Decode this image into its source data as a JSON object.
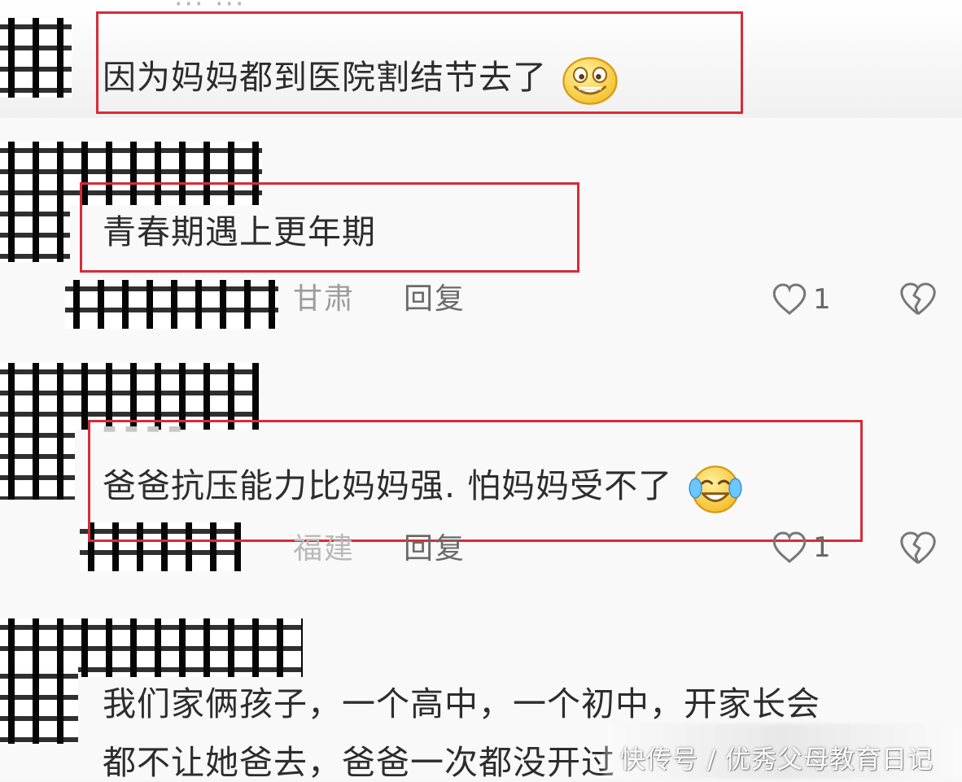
{
  "comments": [
    {
      "text": "因为妈妈都到医院割结节去了",
      "emoji": "grin-emoji"
    },
    {
      "text": "青春期遇上更年期",
      "location": "甘肃",
      "reply": "回复",
      "likes": "1"
    },
    {
      "text": "爸爸抗压能力比妈妈强. 怕妈妈受不了",
      "emoji": "laugh-cry-emoji",
      "location": "福建",
      "reply": "回复",
      "likes": "1"
    },
    {
      "text_line1": "我们家俩孩子，一个高中，一个初中，开家长会",
      "text_line2": "都不让她爸去，爸爸一次都没开过"
    }
  ],
  "watermark": "快传号 / 优秀父母教育日记",
  "icons": {
    "like": "heart-outline-icon",
    "dislike": "broken-heart-icon"
  },
  "colors": {
    "highlight": "#d52d38",
    "text": "#2d2d2d",
    "meta": "#9c9c9c"
  }
}
